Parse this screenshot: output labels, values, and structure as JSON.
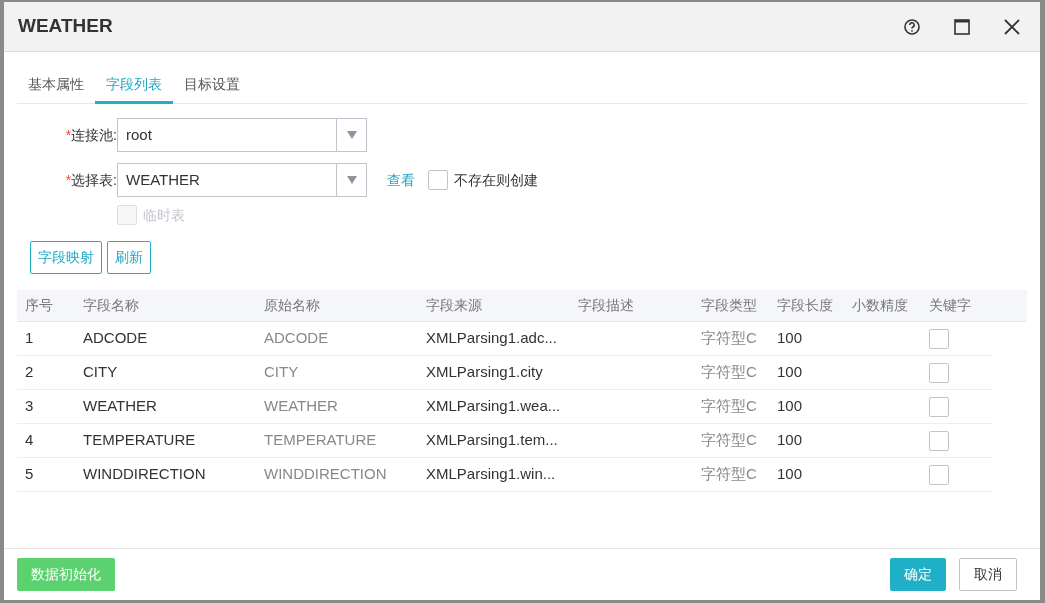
{
  "window": {
    "title": "WEATHER"
  },
  "tabs": [
    {
      "label": "基本属性",
      "selected": false
    },
    {
      "label": "字段列表",
      "selected": true
    },
    {
      "label": "目标设置",
      "selected": false
    }
  ],
  "form": {
    "pool": {
      "required_mark": "*",
      "label": "连接池:",
      "value": "root"
    },
    "table": {
      "required_mark": "*",
      "label": "选择表:",
      "value": "WEATHER",
      "view_link": "查看",
      "create_if_missing": {
        "label": "不存在则创建",
        "checked": false
      }
    },
    "temp_table": {
      "label": "临时表",
      "checked": false,
      "disabled": true
    }
  },
  "actions": [
    "字段映射",
    "刷新"
  ],
  "table": {
    "columns": [
      "序号",
      "字段名称",
      "原始名称",
      "字段来源",
      "字段描述",
      "字段类型",
      "字段长度",
      "小数精度",
      "关键字"
    ],
    "rows": [
      {
        "index": "1",
        "name": "ADCODE",
        "original": "ADCODE",
        "source": "XMLParsing1.adc...",
        "type": "字符型C",
        "length": "100",
        "key": false
      },
      {
        "index": "2",
        "name": "CITY",
        "original": "CITY",
        "source": "XMLParsing1.city",
        "type": "字符型C",
        "length": "100",
        "key": false
      },
      {
        "index": "3",
        "name": "WEATHER",
        "original": "WEATHER",
        "source": "XMLParsing1.wea...",
        "type": "字符型C",
        "length": "100",
        "key": false
      },
      {
        "index": "4",
        "name": "TEMPERATURE",
        "original": "TEMPERATURE",
        "source": "XMLParsing1.tem...",
        "type": "字符型C",
        "length": "100",
        "key": false
      },
      {
        "index": "5",
        "name": "WINDDIRECTION",
        "original": "WINDDIRECTION",
        "source": "XMLParsing1.win...",
        "type": "字符型C",
        "length": "100",
        "key": false
      }
    ]
  },
  "footer": {
    "init_button": "数据初始化",
    "ok_button": "确定",
    "cancel_button": "取消"
  }
}
